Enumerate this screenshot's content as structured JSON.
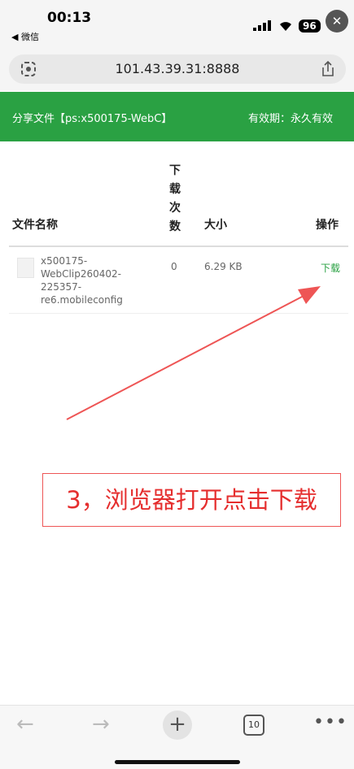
{
  "status_bar": {
    "time": "00:13",
    "back_app": "◀ 微信",
    "battery": "96"
  },
  "browser": {
    "url": "101.43.39.31:8888",
    "tab_count": "10"
  },
  "header": {
    "title": "分享文件【ps:x500175-WebC】",
    "validity": "有效期：永久有效"
  },
  "table": {
    "columns": {
      "name": "文件名称",
      "count": "下载次数",
      "size": "大小",
      "action": "操作"
    },
    "rows": [
      {
        "name": "x500175-WebClip260402-225357-re6.mobileconfig",
        "count": "0",
        "size": "6.29 KB",
        "action": "下载"
      }
    ]
  },
  "annotation": {
    "text": "3，浏览器打开点击下载",
    "color": "#e52e2e"
  },
  "colors": {
    "accent": "#2aa143"
  }
}
